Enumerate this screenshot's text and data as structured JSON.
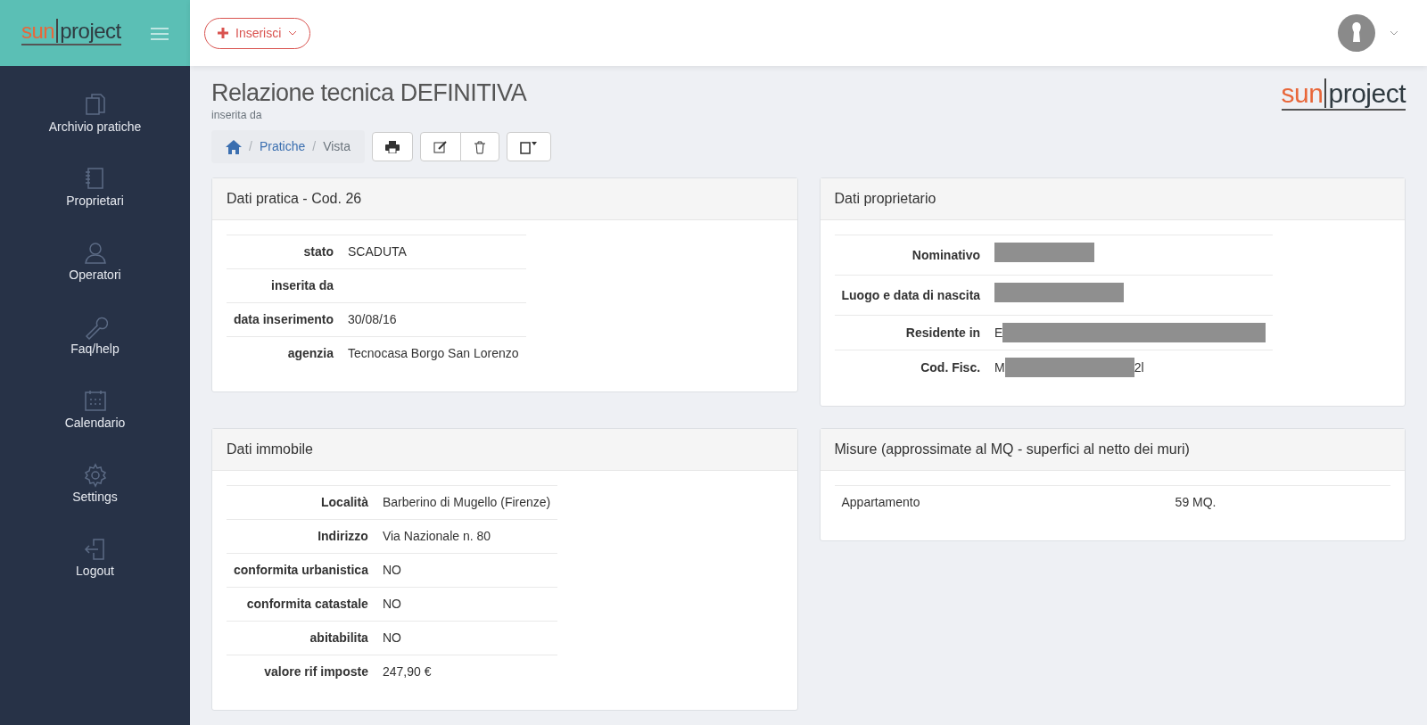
{
  "sidebar": {
    "logo": {
      "part1": "sun",
      "part2": "project"
    },
    "items": [
      {
        "label": "Archivio pratiche",
        "kind": "documents"
      },
      {
        "label": "Proprietari",
        "kind": "notebook"
      },
      {
        "label": "Operatori",
        "kind": "user"
      },
      {
        "label": "Faq/help",
        "kind": "wrench"
      },
      {
        "label": "Calendario",
        "kind": "calendar"
      },
      {
        "label": "Settings",
        "kind": "gear"
      },
      {
        "label": "Logout",
        "kind": "logout"
      }
    ]
  },
  "topbar": {
    "insert_button": "Inserisci"
  },
  "page": {
    "title": "Relazione tecnica DEFINITIVA",
    "subtitle": "inserita da",
    "logo": {
      "part1": "sun",
      "part2": "project"
    },
    "separator": "/",
    "breadcrumb": [
      {
        "label": "Pratiche",
        "link": true
      },
      {
        "label": "Vista",
        "link": false
      }
    ]
  },
  "cards": [
    {
      "title": "Dati pratica - Cod. 26",
      "rows": [
        {
          "label": "stato",
          "value": "SCADUTA"
        },
        {
          "label": "inserita da",
          "value": ""
        },
        {
          "label": "data inserimento",
          "value": "30/08/16"
        },
        {
          "label": "agenzia",
          "value": "Tecnocasa Borgo San Lorenzo"
        }
      ]
    },
    {
      "title": "Dati proprietario",
      "rows": [
        {
          "label": "Nominativo",
          "value": "",
          "redacted": true
        },
        {
          "label": "Luogo e data di nascita",
          "value": "",
          "redacted": true
        },
        {
          "label": "Residente in",
          "value": "E",
          "redacted": true
        },
        {
          "label": "Cod. Fisc.",
          "value": "M",
          "value_end": "2l",
          "redacted": true
        }
      ]
    },
    {
      "title": "Dati immobile",
      "rows": [
        {
          "label": "Località",
          "value": "Barberino di Mugello (Firenze)"
        },
        {
          "label": "Indirizzo",
          "value": "Via Nazionale n. 80"
        },
        {
          "label": "conformita urbanistica",
          "value": "NO"
        },
        {
          "label": "conformita catastale",
          "value": "NO"
        },
        {
          "label": "abitabilita",
          "value": "NO"
        },
        {
          "label": "valore rif imposte",
          "value": "247,90 €"
        }
      ]
    },
    {
      "title": "Misure (approssimate al MQ - superfici al netto dei muri)",
      "plain": true,
      "rows": [
        {
          "label": "Appartamento",
          "value": "59 MQ."
        }
      ]
    }
  ]
}
